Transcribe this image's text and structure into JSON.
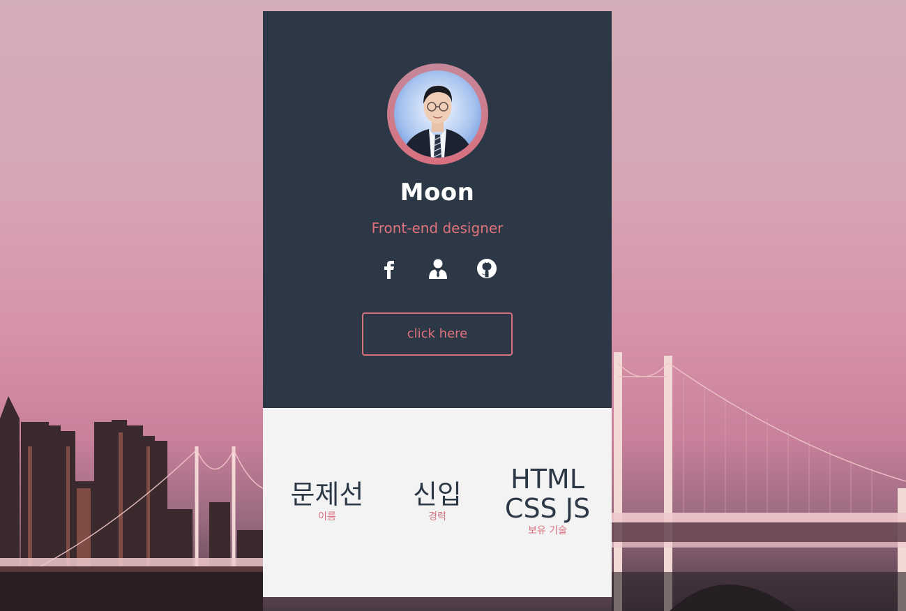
{
  "profile": {
    "name": "Moon",
    "role": "Front-end designer",
    "avatar_alt": "profile photo"
  },
  "socials": [
    {
      "icon": "facebook-icon"
    },
    {
      "icon": "user-icon"
    },
    {
      "icon": "github-icon"
    }
  ],
  "cta": {
    "label": "click here"
  },
  "stats": [
    {
      "value": "문제선",
      "label": "이름"
    },
    {
      "value": "신입",
      "label": "경력"
    },
    {
      "value": "HTML\nCSS JS",
      "label": "보유 기술"
    }
  ],
  "colors": {
    "card_dark": "#2c3846",
    "card_light": "#f3f3f4",
    "accent": "#e0727c",
    "text_light": "#ffffff"
  }
}
